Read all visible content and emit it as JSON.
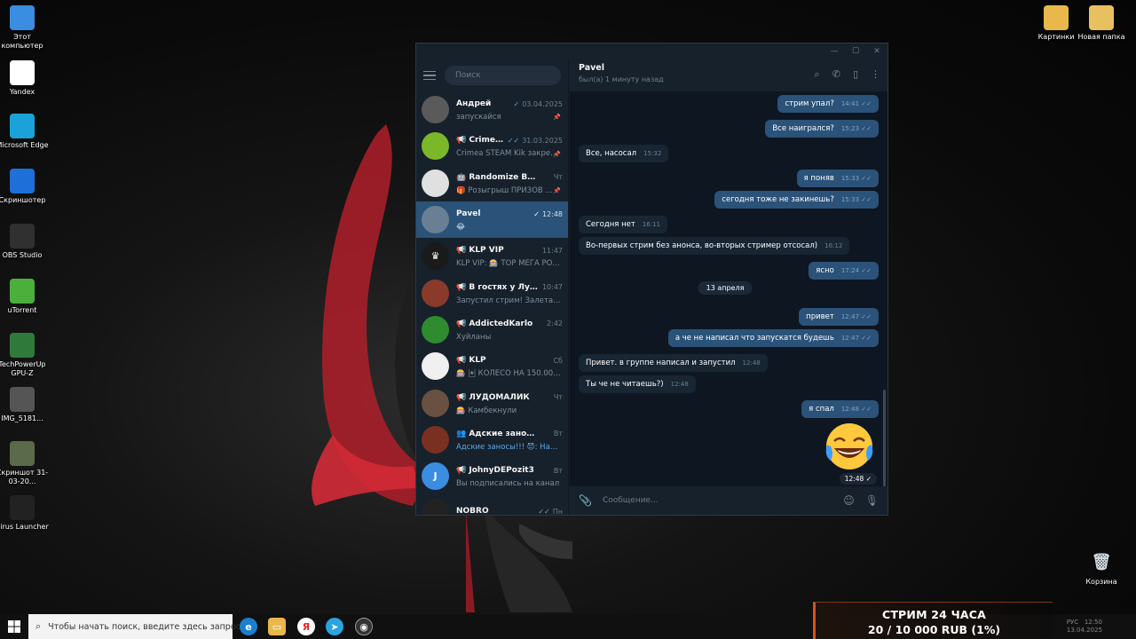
{
  "desktop": {
    "icons_left": [
      {
        "label": "Этот компьютер",
        "icon": "computer-icon",
        "color": "#3a8de0"
      },
      {
        "label": "Yandex",
        "icon": "yandex-icon",
        "color": "#ffffff"
      },
      {
        "label": "Microsoft Edge",
        "icon": "edge-icon",
        "color": "#1ba3d9"
      },
      {
        "label": "Скриншотер",
        "icon": "screenshot-icon",
        "color": "#1e6fd8"
      },
      {
        "label": "OBS Studio",
        "icon": "obs-icon",
        "color": "#303030"
      },
      {
        "label": "uTorrent",
        "icon": "utorrent-icon",
        "color": "#4caf3c"
      },
      {
        "label": "TechPowerUp GPU-Z",
        "icon": "gpuz-icon",
        "color": "#2f7a3a"
      },
      {
        "label": "IMG_5181...",
        "icon": "image-file-icon",
        "color": "#555555"
      },
      {
        "label": "Скриншот 31-03-20...",
        "icon": "image-file-icon",
        "color": "#5a6a4a"
      },
      {
        "label": "Sirus Launcher",
        "icon": "sirus-icon",
        "color": "#222222"
      }
    ],
    "icons_right": [
      {
        "label": "Картинки",
        "icon": "folder-icon",
        "color": "#e8b84a"
      },
      {
        "label": "Новая папка",
        "icon": "folder-icon",
        "color": "#e8c060"
      }
    ],
    "recycle_bin": {
      "label": "Корзина",
      "icon": "recycle-bin-icon"
    }
  },
  "telegram": {
    "search_placeholder": "Поиск",
    "chats": [
      {
        "name": "Андрей",
        "time": "03.04.2025",
        "preview": "запускайся",
        "avatar_color": "#5a5a5a",
        "avatar_text": "",
        "check": "✓",
        "pinned": true
      },
      {
        "name": "📢 Crimea ST...",
        "time": "31.03.2025",
        "preview": "Crimea STEAM Kik закре...",
        "avatar_color": "#7ab829",
        "avatar_text": "",
        "check": "✓✓",
        "pinned": true
      },
      {
        "name": "🤖 Randomize Bot 🎲 [...",
        "time": "Чт",
        "preview": "🎁 Розыгрыш ПРИЗОВ ...",
        "avatar_color": "#e0e0e0",
        "avatar_text": "",
        "check": "",
        "pinned": true
      },
      {
        "name": "Pavel",
        "time": "12:48",
        "preview": "😂",
        "avatar_color": "#6a7f94",
        "avatar_text": "",
        "check": "✓",
        "pinned": false,
        "active": true
      },
      {
        "name": "📢 KLP VIP",
        "time": "11:47",
        "preview": "KLP VIP: 🎰 TOP МЕГА РОЗЫ...",
        "avatar_color": "#1a1a1a",
        "avatar_text": "♛",
        "check": "",
        "pinned": false
      },
      {
        "name": "📢 В гостях у Лудоде...",
        "time": "10:47",
        "preview": "Запустил стрим! Залетайте!",
        "avatar_color": "#8a3a2a",
        "avatar_text": "",
        "check": "",
        "pinned": false
      },
      {
        "name": "📢 AddictedKarlo",
        "time": "2:42",
        "preview": "Хуйланы",
        "avatar_color": "#2e8b2e",
        "avatar_text": "",
        "check": "",
        "pinned": false
      },
      {
        "name": "📢 KLP",
        "time": "Сб",
        "preview": "🎰 🃏 КОЛЕСО НА 150.000 ...",
        "avatar_color": "#f0f0f0",
        "avatar_text": "",
        "check": "",
        "pinned": false
      },
      {
        "name": "📢 ЛУДОМАЛИК",
        "time": "Чт",
        "preview": "🎰 Камбекнули",
        "avatar_color": "#6a5040",
        "avatar_text": "",
        "check": "",
        "pinned": false
      },
      {
        "name": "👥 Адские заносы!!! 😈",
        "time": "Вт",
        "preview": "Адские заносы!!! 😈: Надо т...",
        "avatar_color": "#7a3020",
        "avatar_text": "",
        "check": "",
        "pinned": false,
        "accent": true
      },
      {
        "name": "📢 JohnyDEPozit3",
        "time": "Вт",
        "preview": "Вы подписались на канал",
        "avatar_color": "#3a8de0",
        "avatar_text": "J",
        "check": "",
        "pinned": false
      },
      {
        "name": "NOBRO",
        "time": "Пн",
        "preview": "",
        "avatar_color": "#222222",
        "avatar_text": "",
        "check": "✓✓",
        "pinned": false
      }
    ],
    "header": {
      "name": "Pavel",
      "status": "был(а) 1 минуту назад"
    },
    "messages": [
      {
        "dir": "out",
        "text": "стрим упал?",
        "time": "14:41"
      },
      {
        "dir": "out",
        "text": "Все наигрался?",
        "time": "15:23"
      },
      {
        "dir": "in",
        "text": "Все, насосал",
        "time": "15:32"
      },
      {
        "dir": "out",
        "text": "я поняв",
        "time": "15:33"
      },
      {
        "dir": "out",
        "text": "сегодня тоже не закинешь?",
        "time": "15:33"
      },
      {
        "dir": "in",
        "text": "Сегодня нет",
        "time": "16:11"
      },
      {
        "dir": "in",
        "text": "Во-первых стрим без анонса, во-вторых стример отсосал)",
        "time": "16:12"
      },
      {
        "dir": "out",
        "text": "ясно",
        "time": "17:24"
      },
      {
        "dir": "out",
        "text": "привет",
        "time": "12:47"
      },
      {
        "dir": "out",
        "text": "а че не написал что запускатся будешь",
        "time": "12:47"
      },
      {
        "dir": "in",
        "text": "Привет. в группе написал и запустил",
        "time": "12:48"
      },
      {
        "dir": "in",
        "text": "Ты че не читаешь?)",
        "time": "12:48"
      },
      {
        "dir": "out",
        "text": "я спал",
        "time": "12:48"
      }
    ],
    "date_separator": "13 апреля",
    "sticker_time": "12:48",
    "composer_placeholder": "Сообщение..."
  },
  "taskbar": {
    "search_placeholder": "Чтобы начать поиск, введите здесь запрос",
    "apps": [
      "edge-icon",
      "explorer-icon",
      "yandex-icon",
      "telegram-icon",
      "obs-icon"
    ],
    "tray_lang": "РУС",
    "tray_time": "12:50",
    "tray_date": "13.04.2025"
  },
  "overlay": {
    "title": "СТРИМ 24 ЧАСА",
    "goal": "20 / 10 000 RUB (1%)",
    "accent": "#d4541c"
  }
}
